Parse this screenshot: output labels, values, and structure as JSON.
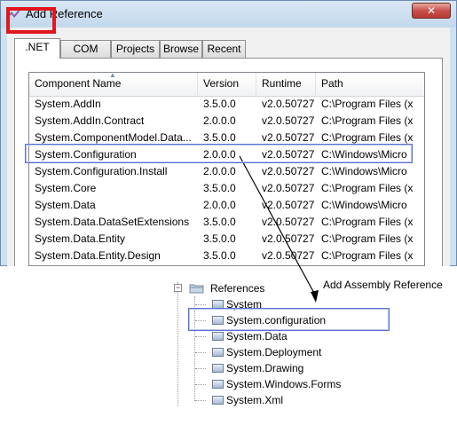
{
  "window": {
    "title": "Add Reference",
    "close_glyph": "✕"
  },
  "tabs": [
    {
      "label": ".NET",
      "active": true
    },
    {
      "label": "COM",
      "active": false
    },
    {
      "label": "Projects",
      "active": false
    },
    {
      "label": "Browse",
      "active": false
    },
    {
      "label": "Recent",
      "active": false
    }
  ],
  "list": {
    "columns": [
      "Component Name",
      "Version",
      "Runtime",
      "Path"
    ],
    "rows": [
      [
        "System.AddIn",
        "3.5.0.0",
        "v2.0.50727",
        "C:\\Program Files (x"
      ],
      [
        "System.AddIn.Contract",
        "2.0.0.0",
        "v2.0.50727",
        "C:\\Program Files (x"
      ],
      [
        "System.ComponentModel.Data...",
        "3.5.0.0",
        "v2.0.50727",
        "C:\\Program Files (x"
      ],
      [
        "System.Configuration",
        "2.0.0.0",
        "v2.0.50727",
        "C:\\Windows\\Micro"
      ],
      [
        "System.Configuration.Install",
        "2.0.0.0",
        "v2.0.50727",
        "C:\\Windows\\Micro"
      ],
      [
        "System.Core",
        "3.5.0.0",
        "v2.0.50727",
        "C:\\Program Files (x"
      ],
      [
        "System.Data",
        "2.0.0.0",
        "v2.0.50727",
        "C:\\Windows\\Micro"
      ],
      [
        "System.Data.DataSetExtensions",
        "3.5.0.0",
        "v2.0.50727",
        "C:\\Program Files (x"
      ],
      [
        "System.Data.Entity",
        "3.5.0.0",
        "v2.0.50727",
        "C:\\Program Files (x"
      ],
      [
        "System.Data.Entity.Design",
        "3.5.0.0",
        "v2.0.50727",
        "C:\\Program Files (x"
      ]
    ],
    "highlighted_row": "System.Configuration"
  },
  "annotation": {
    "label": "Add Assembly Reference"
  },
  "tree": {
    "root": "References",
    "items": [
      "System",
      "System.configuration",
      "System.Data",
      "System.Deployment",
      "System.Drawing",
      "System.Windows.Forms",
      "System.Xml"
    ],
    "highlighted_item": "System.configuration"
  },
  "colors": {
    "highlight_red": "#e0171c",
    "highlight_blue": "#5a6fd0",
    "titlebar": "#cfe0f1"
  }
}
